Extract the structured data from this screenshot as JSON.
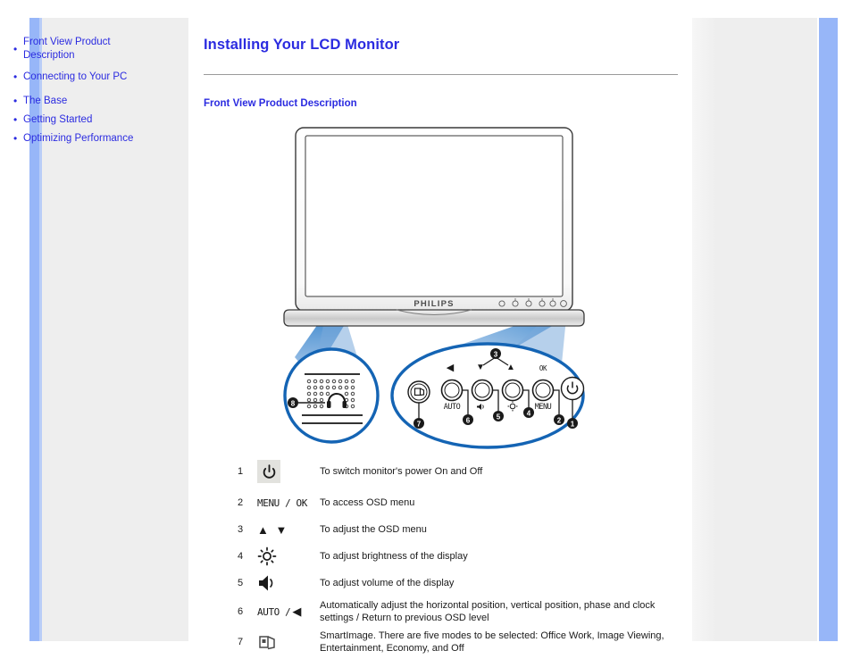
{
  "sidebar": {
    "items": [
      {
        "label": "Front View Product Description",
        "two_line": true
      },
      {
        "label": "Connecting to Your PC",
        "two_line": false
      },
      {
        "label": "The Base",
        "two_line": false
      },
      {
        "label": "Getting Started",
        "two_line": false
      },
      {
        "label": "Optimizing Performance",
        "two_line": false
      }
    ]
  },
  "main": {
    "title": "Installing Your LCD Monitor",
    "section_heading": "Front View Product Description"
  },
  "figure": {
    "brand_logo": "PHILIPS",
    "callout_labels": [
      "1",
      "2",
      "3",
      "4",
      "5",
      "6",
      "7",
      "8"
    ],
    "panel_marks": {
      "auto": "AUTO",
      "menu": "MENU",
      "ok": "OK"
    }
  },
  "legend": {
    "rows": [
      {
        "num": "1",
        "icon": "power-icon",
        "icon_label": "",
        "text": "To switch monitor's power On and Off"
      },
      {
        "num": "2",
        "icon": "menu-ok-icon",
        "icon_label": "MENU / OK",
        "text": "To access OSD menu"
      },
      {
        "num": "3",
        "icon": "up-down-arrows-icon",
        "icon_label": "▲ ▼",
        "text": "To adjust the OSD menu"
      },
      {
        "num": "4",
        "icon": "brightness-icon",
        "icon_label": "",
        "text": "To adjust brightness of the display"
      },
      {
        "num": "5",
        "icon": "volume-icon",
        "icon_label": "",
        "text": "To adjust volume of the display"
      },
      {
        "num": "6",
        "icon": "auto-back-icon",
        "icon_label": "AUTO /",
        "text": "Automatically adjust the horizontal position, vertical position, phase and clock settings / Return to previous OSD level"
      },
      {
        "num": "7",
        "icon": "smartimage-icon",
        "icon_label": "",
        "text": "SmartImage. There are five modes to be selected: Office Work, Image Viewing, Entertainment, Economy, and Off"
      }
    ]
  },
  "colors": {
    "link_blue": "#2b2be0",
    "accent_blue": "#97b6f8",
    "panel_grey": "#eeeeee",
    "callout_blue": "#1464b4",
    "beam_blue": "#6f9fd8"
  }
}
